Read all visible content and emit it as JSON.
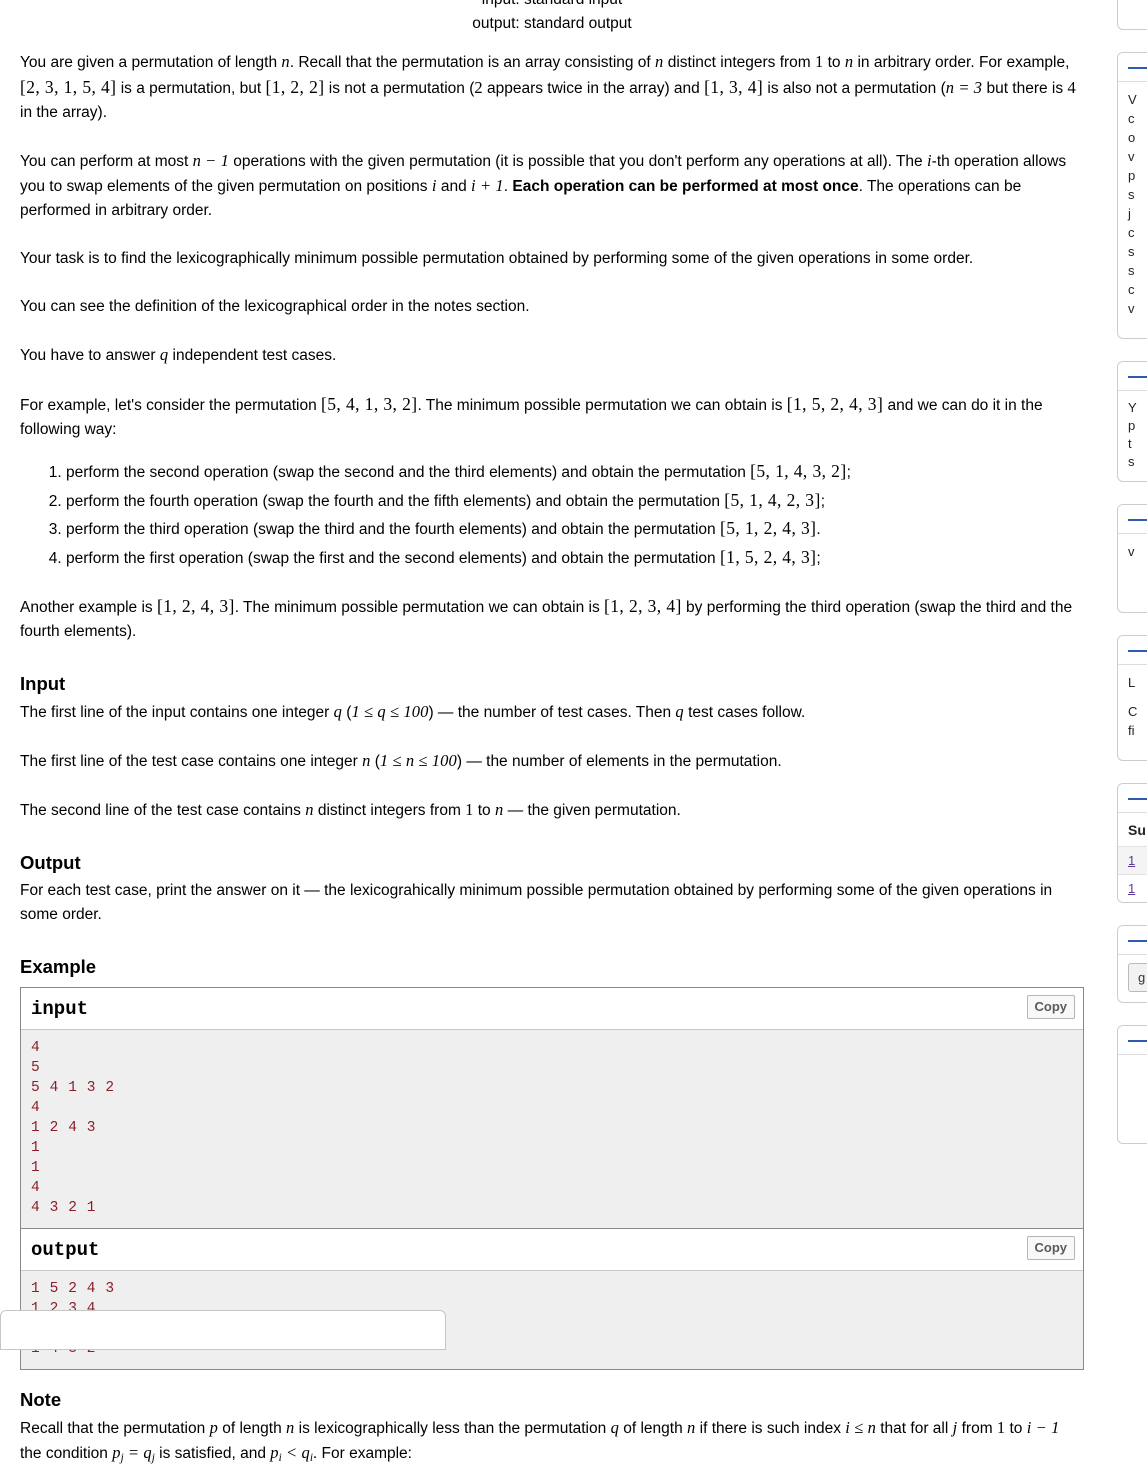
{
  "header": {
    "input_spec": "input: standard input",
    "output_spec": "output: standard output"
  },
  "statement": {
    "p1_a": "You are given a permutation of length ",
    "p1_n": "n",
    "p1_b": ". Recall that the permutation is an array consisting of ",
    "p1_n2": "n",
    "p1_c": " distinct integers from ",
    "p1_one": "1",
    "p1_d": " to ",
    "p1_n3": "n",
    "p1_e": " in arbitrary order. For example, ",
    "p1_arr1": "[2, 3, 1, 5, 4]",
    "p1_f": " is a permutation, but ",
    "p1_arr2": "[1, 2, 2]",
    "p1_g": " is not a permutation (",
    "p1_two": "2",
    "p1_h": " appears twice in the array) and ",
    "p1_arr3": "[1, 3, 4]",
    "p1_i": " is also not a permutation (",
    "p1_neq3": "n = 3",
    "p1_j": " but there is ",
    "p1_four": "4",
    "p1_k": " in the array).",
    "p2_a": "You can perform at most ",
    "p2_nm1": "n − 1",
    "p2_b": " operations with the given permutation (it is possible that you don't perform any operations at all). The ",
    "p2_i": "i",
    "p2_c": "-th operation allows you to swap elements of the given permutation on positions ",
    "p2_i2": "i",
    "p2_d": " and ",
    "p2_ip1": "i + 1",
    "p2_e": ". ",
    "p2_bold": "Each operation can be performed at most once",
    "p2_f": ". The operations can be performed in arbitrary order.",
    "p3": "Your task is to find the lexicographically minimum possible permutation obtained by performing some of the given operations in some order.",
    "p4": "You can see the definition of the lexicographical order in the notes section.",
    "p5_a": "You have to answer ",
    "p5_q": "q",
    "p5_b": " independent test cases.",
    "p6_a": "For example, let's consider the permutation ",
    "p6_arr": "[5, 4, 1, 3, 2]",
    "p6_b": ". The minimum possible permutation we can obtain is ",
    "p6_arr2": "[1, 5, 2, 4, 3]",
    "p6_c": " and we can do it in the following way:",
    "steps": [
      {
        "text_a": "perform the second operation (swap the second and the third elements) and obtain the permutation ",
        "arr": "[5, 1, 4, 3, 2]",
        "text_b": ";"
      },
      {
        "text_a": "perform the fourth operation (swap the fourth and the fifth elements) and obtain the permutation ",
        "arr": "[5, 1, 4, 2, 3]",
        "text_b": ";"
      },
      {
        "text_a": "perform the third operation (swap the third and the fourth elements) and obtain the permutation ",
        "arr": "[5, 1, 2, 4, 3]",
        "text_b": "."
      },
      {
        "text_a": "perform the first operation (swap the first and the second elements) and obtain the permutation ",
        "arr": "[1, 5, 2, 4, 3]",
        "text_b": ";"
      }
    ],
    "p7_a": "Another example is ",
    "p7_arr": "[1, 2, 4, 3]",
    "p7_b": ". The minimum possible permutation we can obtain is ",
    "p7_arr2": "[1, 2, 3, 4]",
    "p7_c": " by performing the third operation (swap the third and the fourth elements).",
    "input_title": "Input",
    "in_p1_a": "The first line of the input contains one integer ",
    "in_p1_q": "q",
    "in_p1_b": " (",
    "in_p1_range": "1 ≤ q ≤ 100",
    "in_p1_c": ") — the number of test cases. Then ",
    "in_p1_q2": "q",
    "in_p1_d": " test cases follow.",
    "in_p2_a": "The first line of the test case contains one integer ",
    "in_p2_n": "n",
    "in_p2_b": " (",
    "in_p2_range": "1 ≤ n ≤ 100",
    "in_p2_c": ") — the number of elements in the permutation.",
    "in_p3_a": "The second line of the test case contains ",
    "in_p3_n": "n",
    "in_p3_b": " distinct integers from ",
    "in_p3_one": "1",
    "in_p3_c": " to ",
    "in_p3_n2": "n",
    "in_p3_d": " — the given permutation.",
    "output_title": "Output",
    "out_p1": "For each test case, print the answer on it — the lexicograhically minimum possible permutation obtained by performing some of the given operations in some order.",
    "example_title": "Example",
    "note_title": "Note",
    "note_a": "Recall that the permutation ",
    "note_p": "p",
    "note_b": " of length ",
    "note_n": "n",
    "note_c": " is lexicographically less than the permutation ",
    "note_q": "q",
    "note_d": " of length ",
    "note_n2": "n",
    "note_e": " if there is such index ",
    "note_ilen": "i ≤ n",
    "note_f": " that for all ",
    "note_j": "j",
    "note_g": " from ",
    "note_one": "1",
    "note_h": " to ",
    "note_im1": "i − 1",
    "note_i": " the condition ",
    "note_cond": "p",
    "note_cond_sub": "j",
    "note_cond2": " = q",
    "note_cond2_sub": "j",
    "note_k": " is satisfied, and ",
    "note_pi": "p",
    "note_pi_sub": "i",
    "note_lt": " < q",
    "note_qi_sub": "i",
    "note_l": ". For example:"
  },
  "samples": {
    "input_label": "input",
    "output_label": "output",
    "copy_label": "Copy",
    "input_data": "4\n5\n5 4 1 3 2\n4\n1 2 4 3\n1\n1\n4\n4 3 2 1",
    "output_data": "1 5 2 4 3\n1 2 3 4\n1\n1 4 3 2"
  },
  "sidebar": {
    "boxes": [
      {
        "lines": [
          "V",
          "c",
          "o",
          "v",
          "p",
          "s",
          "j",
          "c",
          "s",
          "s",
          "c",
          "v"
        ]
      },
      {
        "lines": [
          "Y",
          "p",
          "t",
          "s"
        ]
      },
      {
        "lines": [
          "v"
        ]
      },
      {
        "lines": [
          "L",
          "",
          "C",
          "fi"
        ]
      },
      {
        "title": "Su",
        "rows": [
          "1",
          "1"
        ]
      },
      {
        "button": "g"
      },
      {
        "lines": []
      }
    ]
  },
  "colors": {
    "sample_text": "#8a1f2b",
    "sample_bg": "#efefef",
    "accent_link": "#2a5db0",
    "border": "#888888"
  }
}
